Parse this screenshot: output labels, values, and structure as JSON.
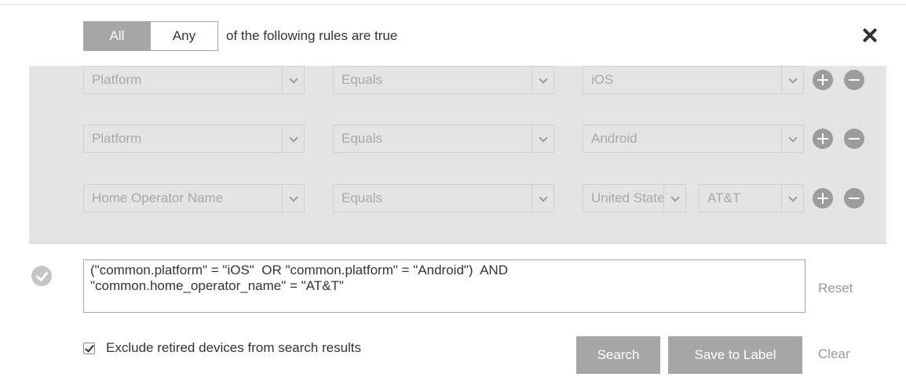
{
  "match": {
    "all_label": "All",
    "any_label": "Any",
    "selected": "All",
    "rules_text": "of the following rules are true"
  },
  "rules": [
    {
      "field": "Platform",
      "operator": "Equals",
      "value": "iOS"
    },
    {
      "field": "Platform",
      "operator": "Equals",
      "value": "Android"
    },
    {
      "field": "Home Operator Name",
      "operator": "Equals",
      "country": "United States",
      "value": "AT&T"
    }
  ],
  "icons": {
    "close": "close-icon",
    "add": "plus-circle-icon",
    "remove": "minus-circle-icon",
    "valid": "check-circle-icon",
    "dropdown": "chevron-down-icon",
    "checkbox": "checkbox-checked-icon"
  },
  "query": {
    "text": "(\"common.platform\" = \"iOS\"  OR \"common.platform\" = \"Android\")  AND\n\"common.home_operator_name\" = \"AT&T\"",
    "reset_label": "Reset"
  },
  "options": {
    "exclude_retired_label": "Exclude retired devices from search results",
    "exclude_retired_checked": true
  },
  "actions": {
    "search_label": "Search",
    "save_label": "Save to Label",
    "clear_label": "Clear"
  },
  "colors": {
    "button_bg": "#a6a6a6",
    "panel_bg": "#e4e4e4",
    "muted_text": "#999999"
  }
}
